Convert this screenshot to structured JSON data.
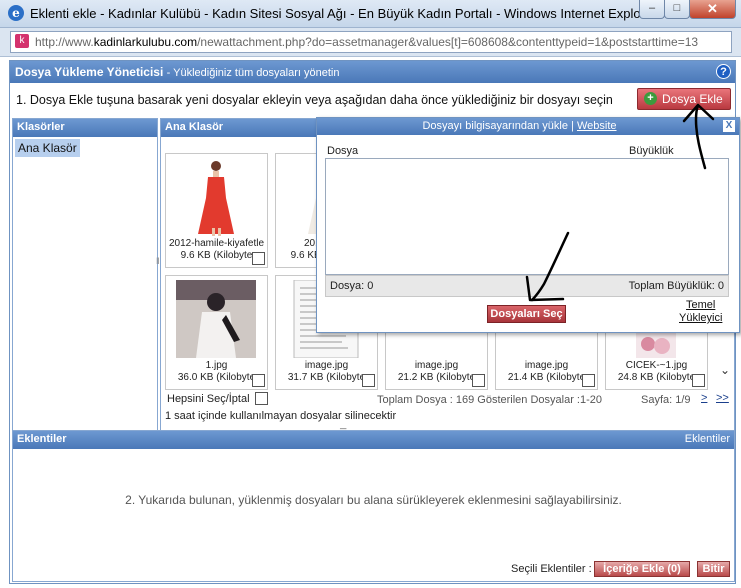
{
  "window": {
    "title": "Eklenti ekle - Kadınlar Kulübü - Kadın Sitesi Sosyal Ağı - En Büyük Kadın Portalı - Windows Internet Explorer",
    "minimize": "–",
    "maximize": "□",
    "close": "✕"
  },
  "address": {
    "prefix": "http://www.",
    "domain": "kadinlarkulubu.com",
    "path": "/newattachment.php?do=assetmanager&values[t]=608608&contenttypeid=1&poststarttime=13"
  },
  "header": {
    "title": "Dosya Yükleme Yöneticisi",
    "subtitle": "- Yüklediğiniz tüm dosyaları yönetin",
    "help": "?"
  },
  "instruction": "1. Dosya Ekle tuşuna basarak yeni dosyalar ekleyin veya aşağıdan daha önce yüklediğiniz bir dosyayı seçin",
  "add_file_button": "Dosya Ekle",
  "folders": {
    "heading": "Klasörler",
    "items": [
      "Ana Klasör"
    ]
  },
  "files": {
    "heading": "Ana Klasör",
    "thumbs": [
      {
        "name": "2012-hamile-kiyafetle",
        "size": "9.6 KB (Kilobyte"
      },
      {
        "name": "2012-ham",
        "size": "9.6 KB (Kilobyte"
      },
      {
        "name": "1.jpg",
        "size": "36.0 KB (Kilobyte"
      },
      {
        "name": "image.jpg",
        "size": "31.7 KB (Kilobyte"
      },
      {
        "name": "image.jpg",
        "size": "21.2 KB (Kilobyte"
      },
      {
        "name": "image.jpg",
        "size": "21.4 KB (Kilobyte"
      },
      {
        "name": "CICEK-~1.jpg",
        "size": "24.8 KB (Kilobyte"
      }
    ],
    "select_all": "Hepsini Seç/İptal",
    "totals": "Toplam Dosya : 169 Gösterilen Dosyalar :1-20",
    "page_info": "Sayfa: 1/9",
    "next": ">",
    "last": ">>",
    "delete_note": "1 saat içinde kullanılmayan dosyalar silinecektir"
  },
  "upload_popup": {
    "title": "Dosyayı bilgisayarından yükle |",
    "website": "Website",
    "close": "X",
    "col_file": "Dosya",
    "col_size": "Büyüklük",
    "count": "Dosya: 0",
    "total_size": "Toplam Büyüklük: 0",
    "choose_files": "Dosyaları Seç",
    "basic_uploader_1": "Temel",
    "basic_uploader_2": "Yükleyici"
  },
  "attachments": {
    "heading": "Eklentiler",
    "heading_right": "Eklentiler",
    "hint": "2. Yukarıda bulunan, yüklenmiş dosyaları bu alana sürükleyerek eklenmesini sağlayabilirsiniz.",
    "selected_label": "Seçili Eklentiler :",
    "insert_button": "İçeriğe Ekle (0)",
    "finish_button": "Bitir"
  },
  "colors": {
    "header_blue": "#4a78b8",
    "button_red": "#b93940",
    "selection_blue": "#b7cfee"
  }
}
